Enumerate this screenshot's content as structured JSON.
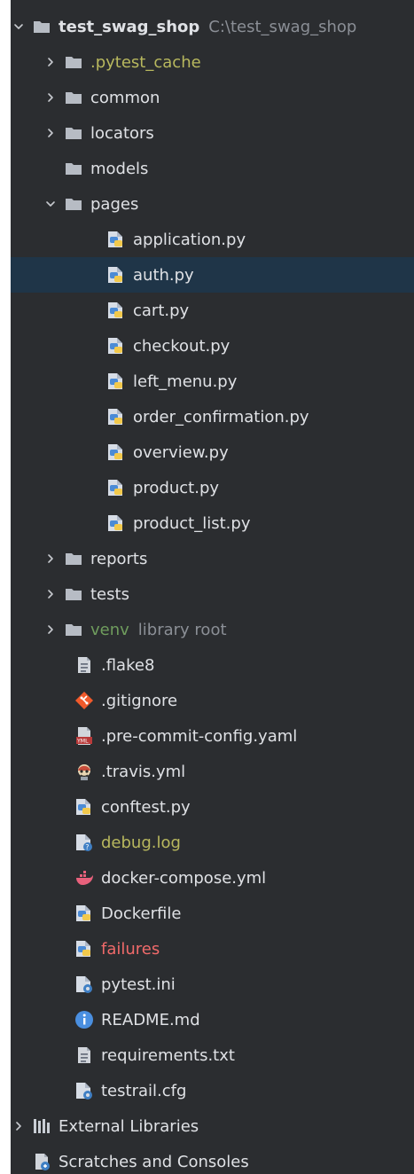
{
  "project": {
    "name": "test_swag_shop",
    "path": "C:\\test_swag_shop"
  },
  "tree": {
    "pytest_cache": ".pytest_cache",
    "common": "common",
    "locators": "locators",
    "models": "models",
    "pages": "pages",
    "page_files": [
      "application.py",
      "auth.py",
      "cart.py",
      "checkout.py",
      "left_menu.py",
      "order_confirmation.py",
      "overview.py",
      "product.py",
      "product_list.py"
    ],
    "reports": "reports",
    "tests": "tests",
    "venv": "venv",
    "venv_badge": "library root",
    "files": [
      ".flake8",
      ".gitignore",
      ".pre-commit-config.yaml",
      ".travis.yml",
      "conftest.py",
      "debug.log",
      "docker-compose.yml",
      "Dockerfile",
      "failures",
      "pytest.ini",
      "README.md",
      "requirements.txt",
      "testrail.cfg"
    ],
    "external_libraries": "External Libraries",
    "scratches": "Scratches and Consoles"
  },
  "colors": {
    "panel_bg": "#2b2d30",
    "selected_bg": "#1f3548",
    "text": "#dfe1e5",
    "muted": "#8b8f96",
    "yellow": "#b8b85e",
    "green": "#6f9c5d",
    "red": "#f06a6a"
  }
}
